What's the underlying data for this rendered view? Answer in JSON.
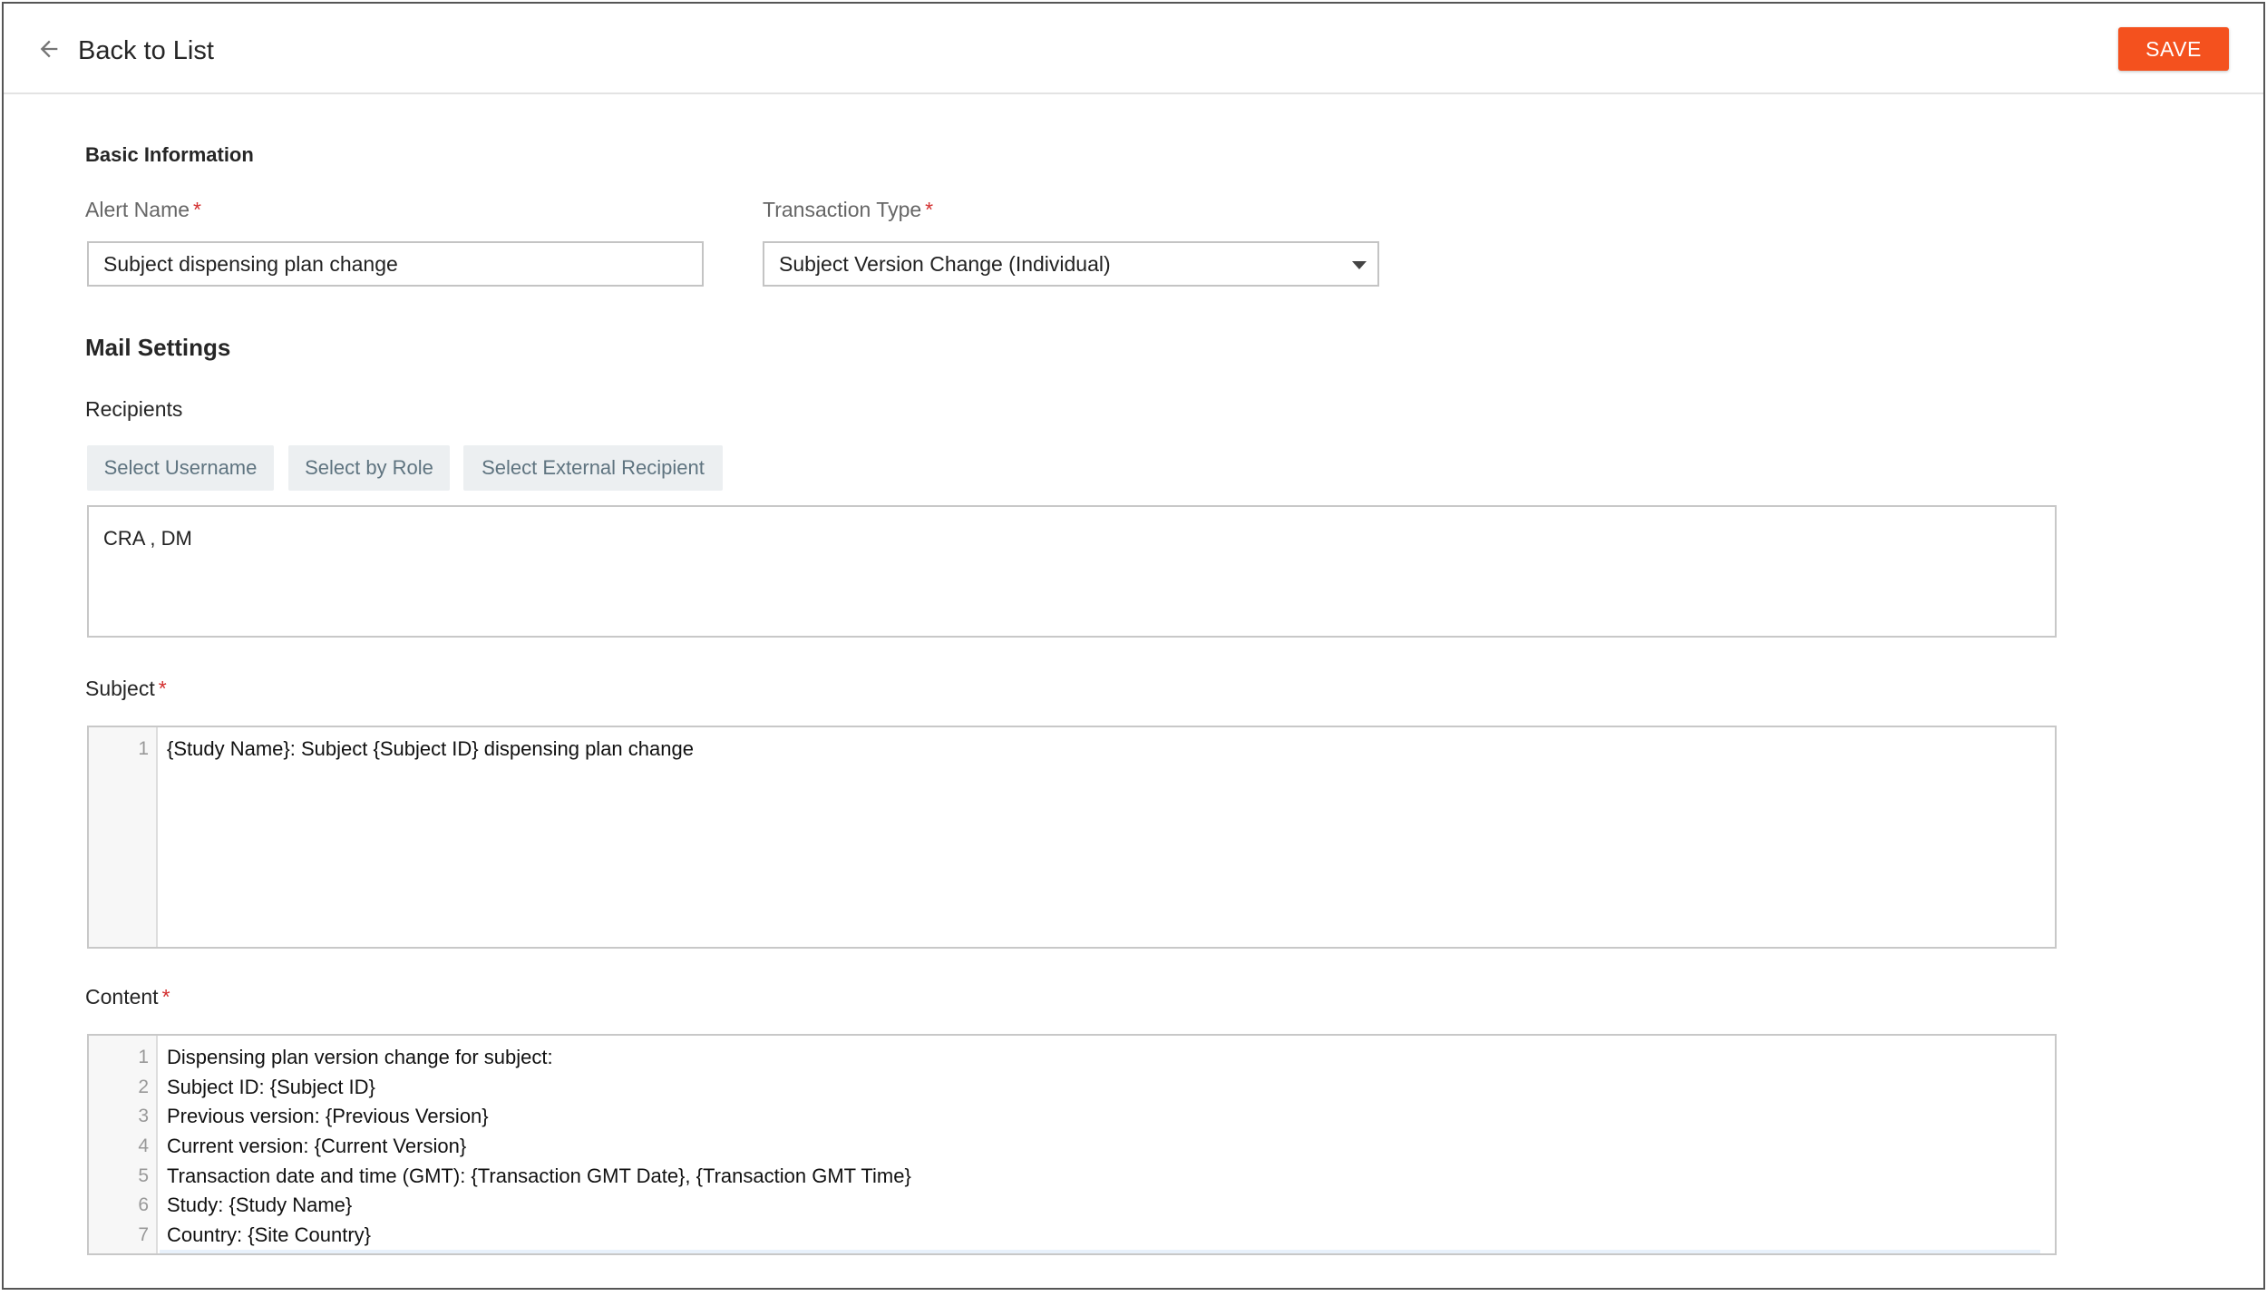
{
  "header": {
    "back_label": "Back to List",
    "save_label": "SAVE",
    "accent_color": "#f4511e"
  },
  "basic_info": {
    "section_title": "Basic Information",
    "alert_name": {
      "label": "Alert Name",
      "required_mark": "*",
      "value": "Subject dispensing plan change"
    },
    "transaction_type": {
      "label": "Transaction Type",
      "required_mark": "*",
      "selected": "Subject Version Change (Individual)"
    }
  },
  "mail_settings": {
    "section_title": "Mail Settings",
    "recipients": {
      "label": "Recipients",
      "buttons": [
        "Select Username",
        "Select by Role",
        "Select External Recipient"
      ],
      "value": "CRA ,  DM"
    },
    "subject": {
      "label": "Subject",
      "required_mark": "*",
      "lines": [
        {
          "no": "1",
          "text": "{Study Name}: Subject {Subject ID} dispensing plan change"
        }
      ]
    },
    "content": {
      "label": "Content",
      "required_mark": "*",
      "lines": [
        {
          "no": "1",
          "text": "Dispensing plan version change for subject:"
        },
        {
          "no": "2",
          "text": "Subject ID: {Subject ID}"
        },
        {
          "no": "3",
          "text": "Previous version: {Previous Version}"
        },
        {
          "no": "4",
          "text": "Current version: {Current Version}"
        },
        {
          "no": "5",
          "text": "Transaction date and time (GMT): {Transaction GMT Date}, {Transaction GMT Time}"
        },
        {
          "no": "6",
          "text": "Study: {Study Name}"
        },
        {
          "no": "7",
          "text": "Country: {Site Country}"
        }
      ]
    }
  }
}
